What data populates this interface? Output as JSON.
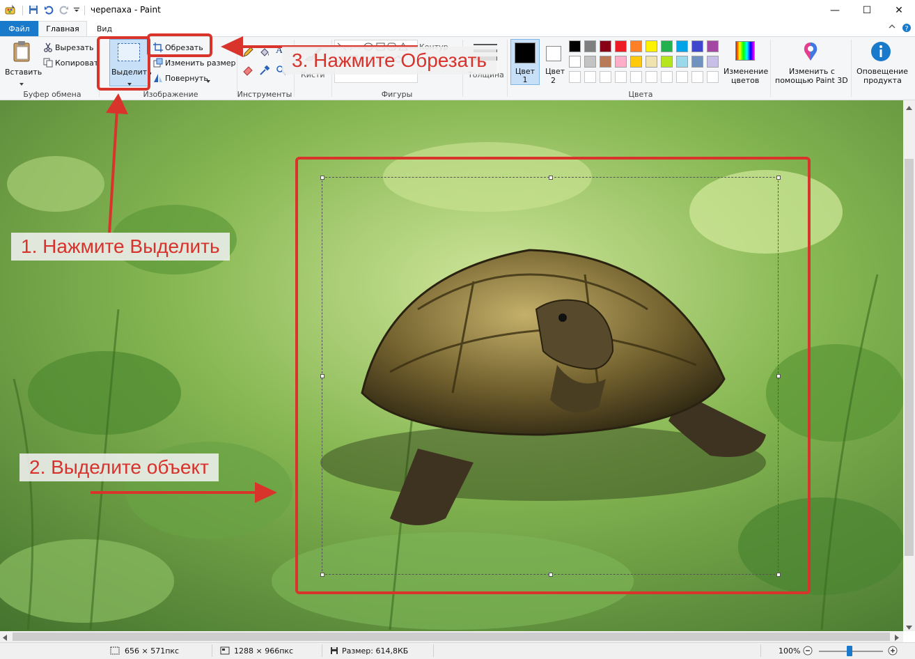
{
  "window": {
    "title": "черепаха - Paint",
    "minimize_glyph": "—",
    "maximize_glyph": "☐",
    "close_glyph": "✕"
  },
  "tabs": {
    "file": "Файл",
    "home": "Главная",
    "view": "Вид"
  },
  "ribbon": {
    "clipboard": {
      "paste": "Вставить",
      "cut": "Вырезать",
      "copy": "Копировать",
      "group": "Буфер обмена"
    },
    "image": {
      "select": "Выделить",
      "crop": "Обрезать",
      "resize": "Изменить размер",
      "rotate": "Повернуть",
      "group": "Изображение"
    },
    "tools": {
      "group": "Инструменты"
    },
    "brushes": {
      "label": "Кисти"
    },
    "shapes": {
      "group": "Фигуры",
      "contour": "Контур"
    },
    "size": {
      "label": "Толщина"
    },
    "colors": {
      "color1": "Цвет 1",
      "color2_line1": "Цвет",
      "color2_line2": "2",
      "edit_line1": "Изменение",
      "edit_line2": "цветов",
      "group": "Цвета",
      "palette_row1": [
        "#000000",
        "#7f7f7f",
        "#880015",
        "#ed1c24",
        "#ff7f27",
        "#fff200",
        "#22b14c",
        "#00a2e8",
        "#3f48cc",
        "#a349a4"
      ],
      "palette_row2": [
        "#ffffff",
        "#c3c3c3",
        "#b97a57",
        "#ffaec9",
        "#ffc90e",
        "#efe4b0",
        "#b5e61d",
        "#99d9ea",
        "#7092be",
        "#c8bfe7"
      ]
    },
    "paint3d": {
      "line1": "Изменить с",
      "line2": "помощью Paint 3D"
    },
    "alerts": {
      "line1": "Оповещение",
      "line2": "продукта"
    }
  },
  "annotations": {
    "step1": "1. Нажмите Выделить",
    "step2": "2. Выделите объект",
    "step3": "3. Нажмите Обрезать"
  },
  "status": {
    "selection_size": "656 × 571пкс",
    "image_size": "1288 × 966пкс",
    "file_size": "Размер: 614,8КБ",
    "zoom": "100%"
  }
}
